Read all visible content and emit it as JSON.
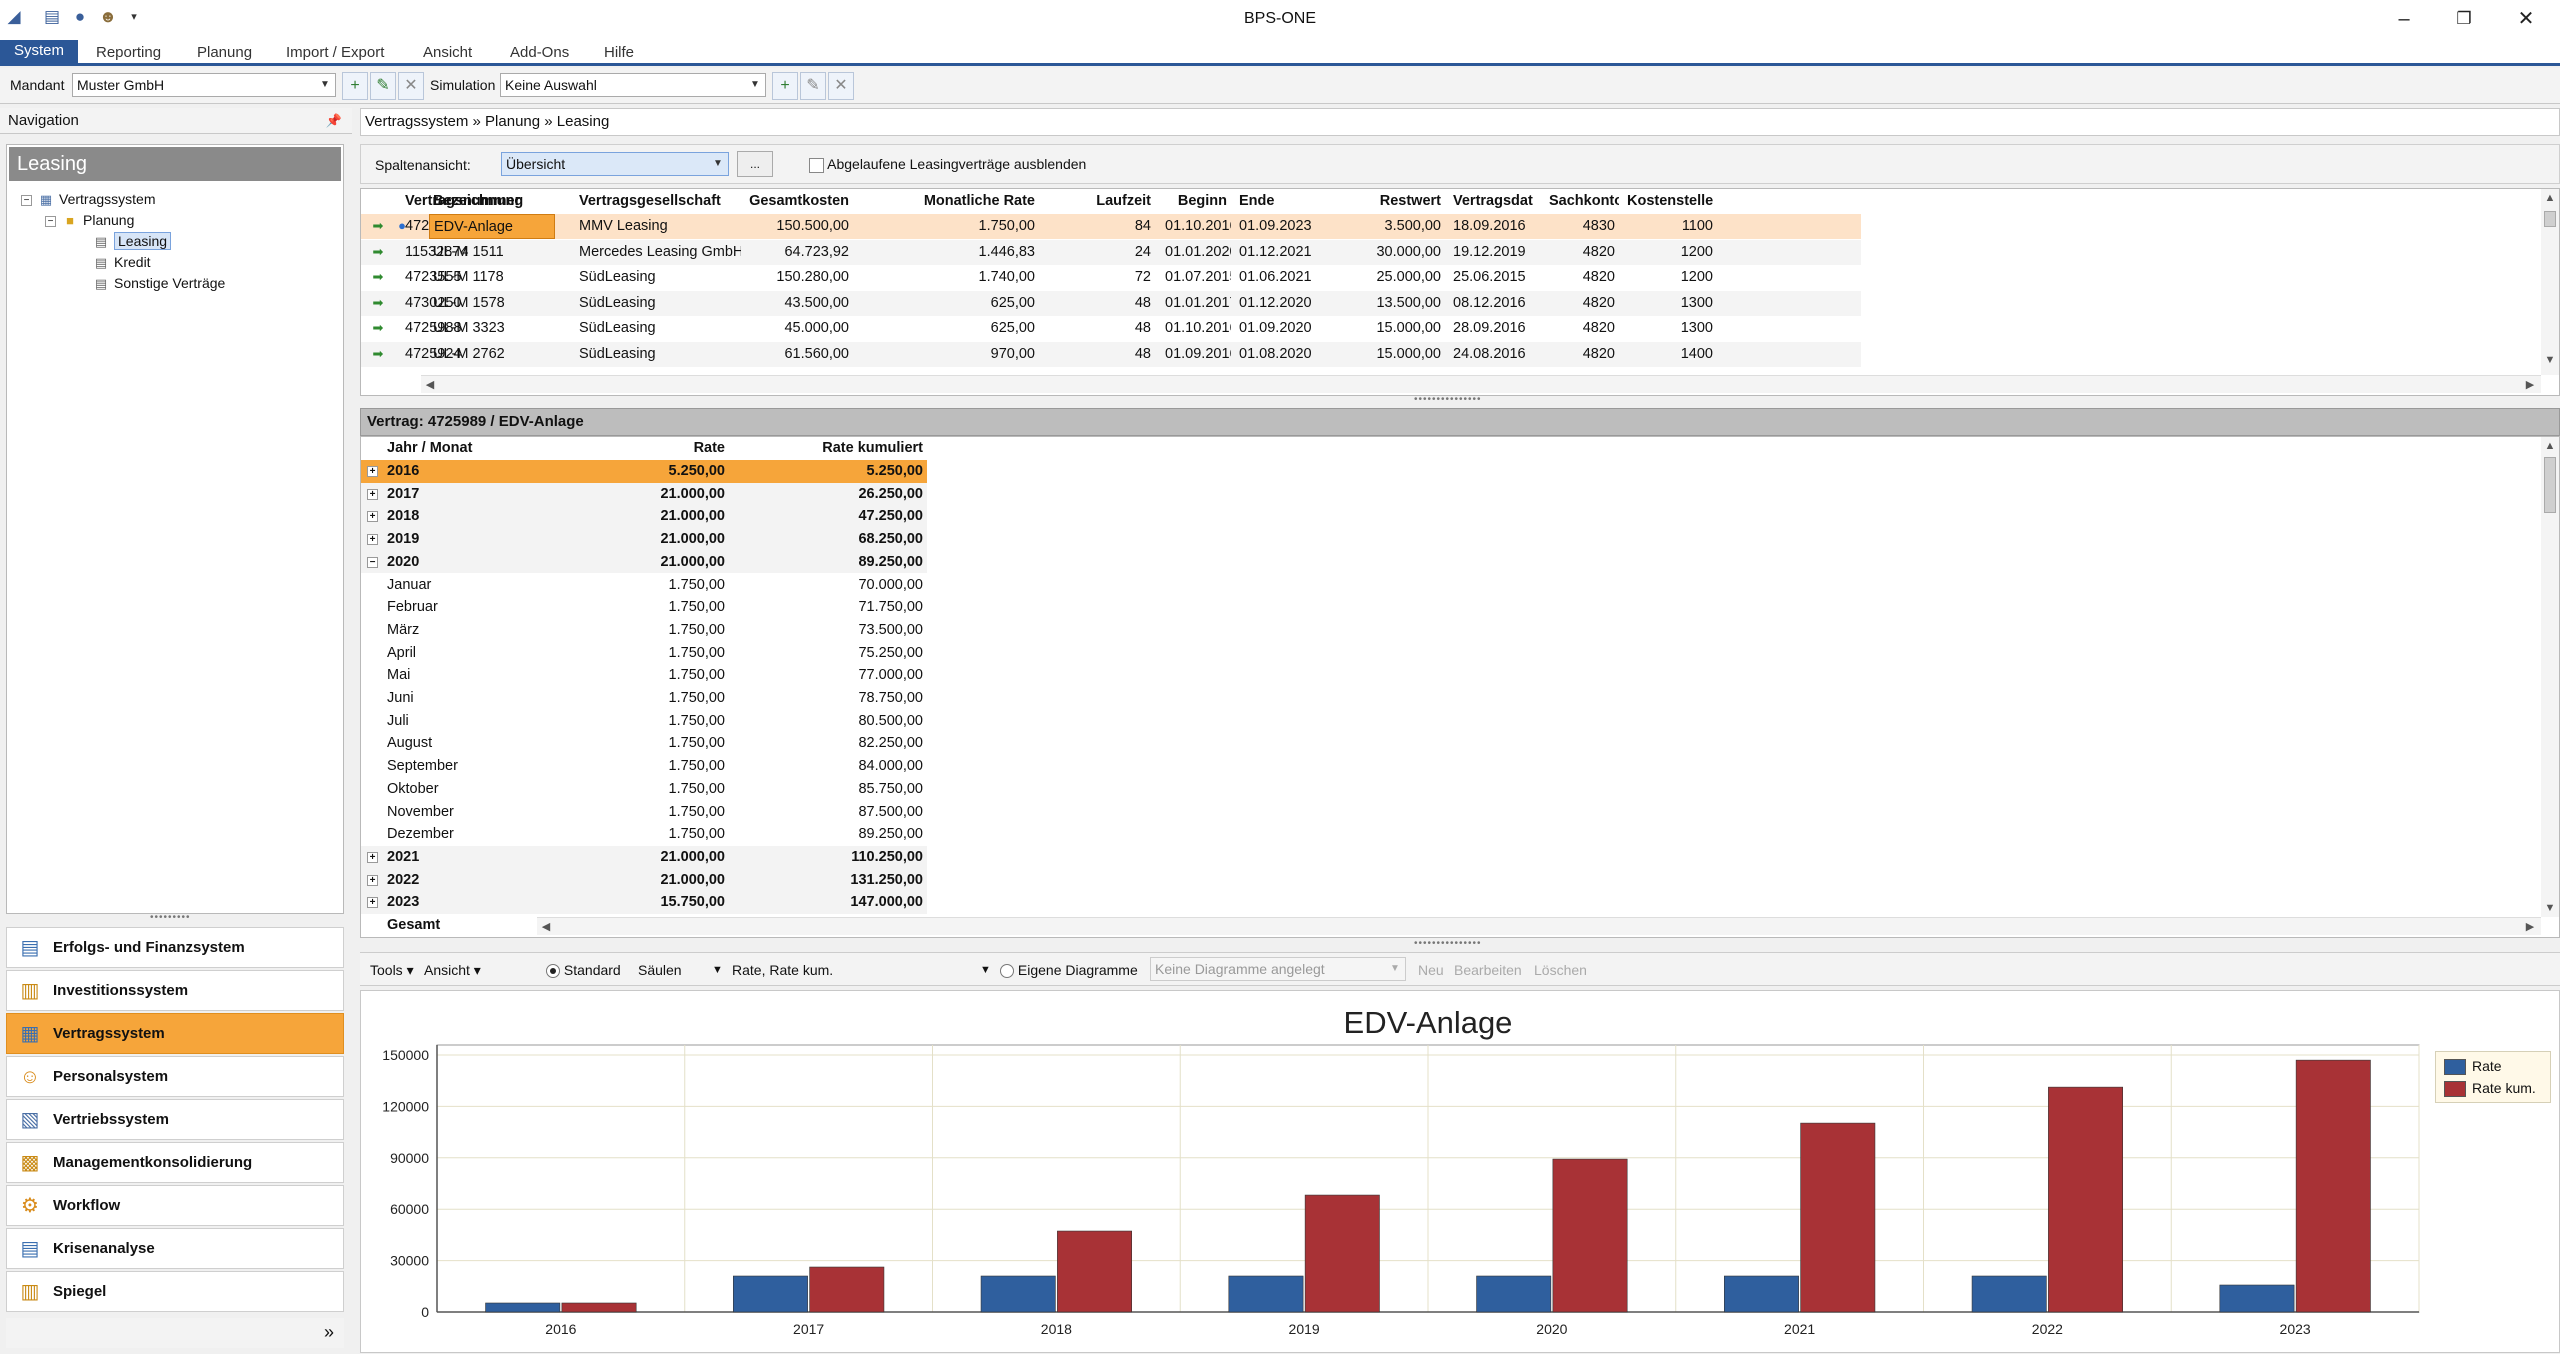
{
  "window": {
    "title": "BPS-ONE",
    "minimize": "–",
    "restore": "❐",
    "close": "✕"
  },
  "menubar": [
    "System",
    "Reporting",
    "Planung",
    "Import / Export",
    "Ansicht",
    "Add-Ons",
    "Hilfe"
  ],
  "toolbar": {
    "mandant_label": "Mandant",
    "mandant_value": "Muster GmbH",
    "simulation_label": "Simulation",
    "simulation_value": "Keine Auswahl"
  },
  "navigation": {
    "header": "Navigation",
    "panel_title": "Leasing",
    "tree": [
      {
        "label": "Vertragssystem",
        "level": 0
      },
      {
        "label": "Planung",
        "level": 1
      },
      {
        "label": "Leasing",
        "level": 2,
        "selected": true
      },
      {
        "label": "Kredit",
        "level": 2
      },
      {
        "label": "Sonstige Verträge",
        "level": 2
      }
    ],
    "modules": [
      {
        "label": "Erfolgs- und Finanzsystem",
        "icon": "chart-icon"
      },
      {
        "label": "Investitionssystem",
        "icon": "folder-icon"
      },
      {
        "label": "Vertragssystem",
        "icon": "contract-icon",
        "active": true
      },
      {
        "label": "Personalsystem",
        "icon": "people-icon"
      },
      {
        "label": "Vertriebssystem",
        "icon": "sales-icon"
      },
      {
        "label": "Managementkonsolidierung",
        "icon": "consolidation-icon"
      },
      {
        "label": "Workflow",
        "icon": "workflow-icon"
      },
      {
        "label": "Krisenanalyse",
        "icon": "analysis-icon"
      },
      {
        "label": "Spiegel",
        "icon": "mirror-icon"
      }
    ],
    "footer_chevron": "»"
  },
  "breadcrumb": "Vertragssystem » Planung » Leasing",
  "filter": {
    "label": "Spaltenansicht:",
    "value": "Übersicht",
    "button": "...",
    "checkbox_label": "Abgelaufene Leasingverträge ausblenden"
  },
  "grid": {
    "columns": [
      "Vertragsnummer",
      "Bezeichnung",
      "Vertragsgesellschaft",
      "Gesamtkosten",
      "Monatliche Rate",
      "Laufzeit",
      "Beginn",
      "Ende",
      "Restwert",
      "Vertragsdat",
      "Sachkonto",
      "Kostenstelle"
    ],
    "rows": [
      [
        "4725989",
        "EDV-Anlage",
        "MMV Leasing",
        "150.500,00",
        "1.750,00",
        "84",
        "01.10.2016",
        "01.09.2023",
        "3.500,00",
        "18.09.2016",
        "4830",
        "1100"
      ],
      [
        "11532874",
        "UL-M 1511",
        "Mercedes Leasing GmbH",
        "64.723,92",
        "1.446,83",
        "24",
        "01.01.2020",
        "01.12.2021",
        "30.000,00",
        "19.12.2019",
        "4820",
        "1200"
      ],
      [
        "4723555",
        "UL-M 1178",
        "SüdLeasing",
        "150.280,00",
        "1.740,00",
        "72",
        "01.07.2015",
        "01.06.2021",
        "25.000,00",
        "25.06.2015",
        "4820",
        "1200"
      ],
      [
        "4730250",
        "UL-M 1578",
        "SüdLeasing",
        "43.500,00",
        "625,00",
        "48",
        "01.01.2017",
        "01.12.2020",
        "13.500,00",
        "08.12.2016",
        "4820",
        "1300"
      ],
      [
        "4725988",
        "UL-M 3323",
        "SüdLeasing",
        "45.000,00",
        "625,00",
        "48",
        "01.10.2016",
        "01.09.2020",
        "15.000,00",
        "28.09.2016",
        "4820",
        "1300"
      ],
      [
        "4725924",
        "UL-M 2762",
        "SüdLeasing",
        "61.560,00",
        "970,00",
        "48",
        "01.09.2016",
        "01.08.2020",
        "15.000,00",
        "24.08.2016",
        "4820",
        "1400"
      ]
    ]
  },
  "detail": {
    "title": "Vertrag: 4725989 / EDV-Anlage",
    "columns": [
      "Jahr / Monat",
      "Rate",
      "Rate kumuliert"
    ],
    "rows": [
      {
        "label": "2016",
        "rate": "5.250,00",
        "cum": "5.250,00",
        "type": "year",
        "sel": true,
        "exp": "+"
      },
      {
        "label": "2017",
        "rate": "21.000,00",
        "cum": "26.250,00",
        "type": "year",
        "exp": "+"
      },
      {
        "label": "2018",
        "rate": "21.000,00",
        "cum": "47.250,00",
        "type": "year",
        "exp": "+"
      },
      {
        "label": "2019",
        "rate": "21.000,00",
        "cum": "68.250,00",
        "type": "year",
        "exp": "+"
      },
      {
        "label": "2020",
        "rate": "21.000,00",
        "cum": "89.250,00",
        "type": "year",
        "exp": "−"
      },
      {
        "label": "Januar",
        "rate": "1.750,00",
        "cum": "70.000,00",
        "type": "month"
      },
      {
        "label": "Februar",
        "rate": "1.750,00",
        "cum": "71.750,00",
        "type": "month"
      },
      {
        "label": "März",
        "rate": "1.750,00",
        "cum": "73.500,00",
        "type": "month"
      },
      {
        "label": "April",
        "rate": "1.750,00",
        "cum": "75.250,00",
        "type": "month"
      },
      {
        "label": "Mai",
        "rate": "1.750,00",
        "cum": "77.000,00",
        "type": "month"
      },
      {
        "label": "Juni",
        "rate": "1.750,00",
        "cum": "78.750,00",
        "type": "month"
      },
      {
        "label": "Juli",
        "rate": "1.750,00",
        "cum": "80.500,00",
        "type": "month"
      },
      {
        "label": "August",
        "rate": "1.750,00",
        "cum": "82.250,00",
        "type": "month"
      },
      {
        "label": "September",
        "rate": "1.750,00",
        "cum": "84.000,00",
        "type": "month"
      },
      {
        "label": "Oktober",
        "rate": "1.750,00",
        "cum": "85.750,00",
        "type": "month"
      },
      {
        "label": "November",
        "rate": "1.750,00",
        "cum": "87.500,00",
        "type": "month"
      },
      {
        "label": "Dezember",
        "rate": "1.750,00",
        "cum": "89.250,00",
        "type": "month"
      },
      {
        "label": "2021",
        "rate": "21.000,00",
        "cum": "110.250,00",
        "type": "year",
        "exp": "+"
      },
      {
        "label": "2022",
        "rate": "21.000,00",
        "cum": "131.250,00",
        "type": "year",
        "exp": "+"
      },
      {
        "label": "2023",
        "rate": "15.750,00",
        "cum": "147.000,00",
        "type": "year",
        "exp": "+"
      },
      {
        "label": "Gesamt",
        "rate": "",
        "cum": "",
        "type": "total"
      }
    ]
  },
  "chart_toolbar": {
    "tools": "Tools",
    "ansicht": "Ansicht",
    "standard_label": "Standard",
    "chart_kind": "Säulen",
    "series_select": "Rate, Rate kum.",
    "eigene_label": "Eigene Diagramme",
    "eigene_placeholder": "Keine Diagramme angelegt",
    "neu": "Neu",
    "bearbeiten": "Bearbeiten",
    "loeschen": "Löschen"
  },
  "chart_data": {
    "type": "bar",
    "title": "EDV-Anlage",
    "categories": [
      "2016",
      "2017",
      "2018",
      "2019",
      "2020",
      "2021",
      "2022",
      "2023"
    ],
    "series": [
      {
        "name": "Rate",
        "values": [
          5250,
          21000,
          21000,
          21000,
          21000,
          21000,
          21000,
          15750
        ],
        "color": "#2f5f9e"
      },
      {
        "name": "Rate kum.",
        "values": [
          5250,
          26250,
          47250,
          68250,
          89250,
          110250,
          131250,
          147000
        ],
        "color": "#a83236"
      }
    ],
    "ylim": [
      0,
      150000
    ],
    "yticks": [
      0,
      30000,
      60000,
      90000,
      120000,
      150000
    ],
    "grid": true,
    "legend": "top-right"
  }
}
